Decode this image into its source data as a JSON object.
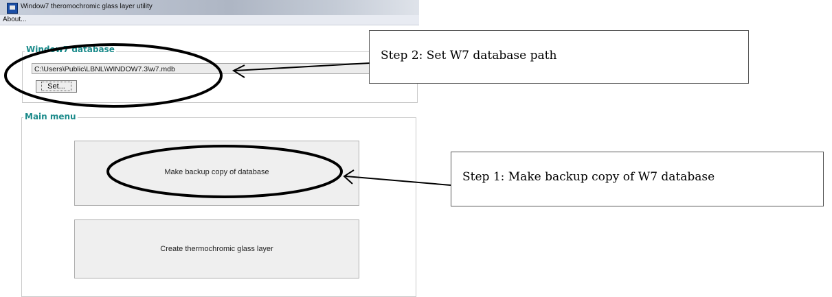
{
  "window": {
    "title": "Window7 theromochromic glass layer utility",
    "icon": "app-icon"
  },
  "menu": {
    "items": [
      {
        "label": "About..."
      }
    ]
  },
  "database_group": {
    "label": "Window7 database",
    "path_value": "C:\\Users\\Public\\LBNL\\WINDOW7.3\\w7.mdb",
    "set_button_label": "Set..."
  },
  "main_menu": {
    "label": "Main menu",
    "backup_button_label": "Make backup copy of database",
    "create_button_label": "Create thermochromic glass layer"
  },
  "annotations": {
    "step2": "Step 2: Set W7 database path",
    "step1": "Step 1: Make backup copy of W7 database"
  }
}
